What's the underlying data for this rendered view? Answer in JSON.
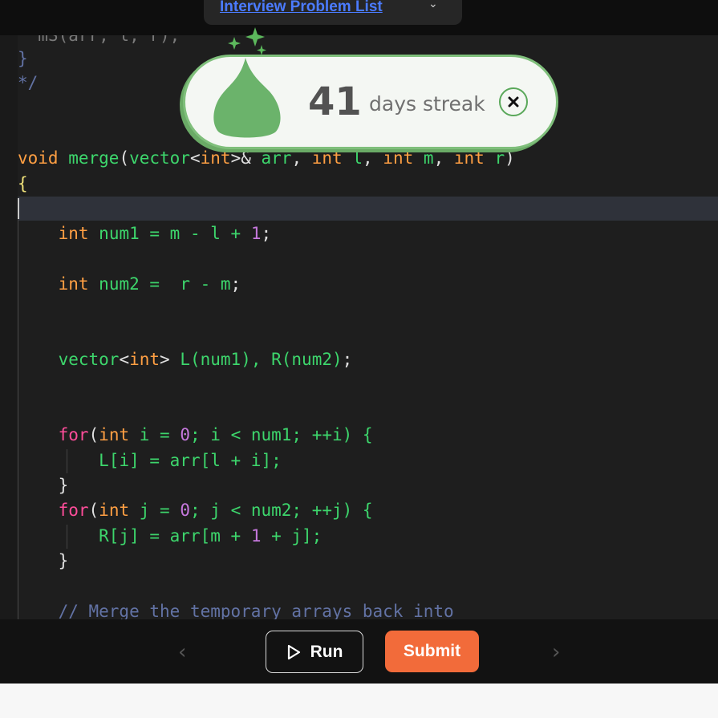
{
  "header": {
    "problem_list_label": "Interview Problem List"
  },
  "editor": {
    "lines": {
      "l1": "  mS(arr, l, r);",
      "l2": "}",
      "l3": "*/",
      "l6_void": "void",
      "l6_merge": "merge",
      "l6_rest1": "(",
      "l6_vector": "vector",
      "l6_lt": "<",
      "l6_int1": "int",
      "l6_gt": ">&",
      "l6_arr": "arr",
      "l6_c1": ",",
      "l6_int2": "int",
      "l6_l": "l",
      "l6_c2": ",",
      "l6_int3": "int",
      "l6_m": "m",
      "l6_c3": ",",
      "l6_int4": "int",
      "l6_r": "r",
      "l6_close": ")",
      "l7": "{",
      "l9_int": "int",
      "l9_rest": "num1 = m - l + ",
      "l9_one": "1",
      "l9_end": ";",
      "l11_int": "int",
      "l11_rest": "num2 =  r - m",
      "l11_end": ";",
      "l14_vector": "vector",
      "l14_lt": "<",
      "l14_int": "int",
      "l14_gt": ">",
      "l14_rest": "L(num1), R(num2)",
      "l14_end": ";",
      "l17_for": "for",
      "l17_p": "(",
      "l17_int": "int",
      "l17_i": "i = ",
      "l17_zero": "0",
      "l17_rest": "; i < num1; ++i) {",
      "l18": "L[i] = arr[l + i];",
      "l19": "}",
      "l20_for": "for",
      "l20_p": "(",
      "l20_int": "int",
      "l20_j": "j = ",
      "l20_zero": "0",
      "l20_rest": "; j < num2; ++j) {",
      "l21_a": "R[j] = arr[m + ",
      "l21_one": "1",
      "l21_b": " + j];",
      "l22": "}",
      "l24": "// Merge the temporary arrays back into"
    }
  },
  "streak": {
    "count": "41",
    "label": "days streak",
    "accent": "#7fbf7b"
  },
  "footer": {
    "run_label": "Run",
    "submit_label": "Submit",
    "submit_color": "#f26b3a",
    "prev_icon": "chevron-left-icon",
    "next_icon": "chevron-right-icon"
  }
}
